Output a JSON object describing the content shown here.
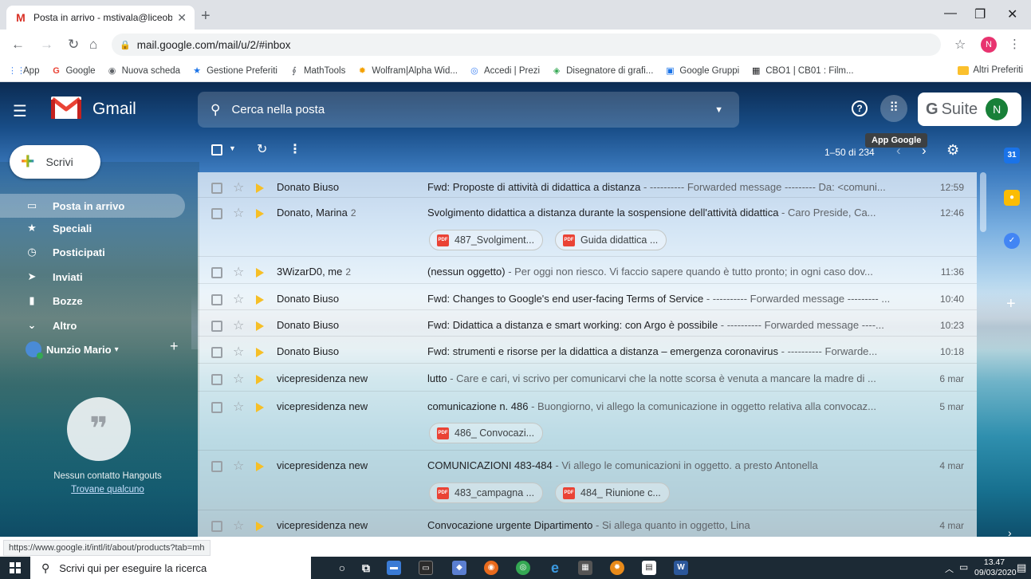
{
  "browser": {
    "tab_title": "Posta in arrivo - mstivala@liceob",
    "new_tab_label": "+",
    "url": "mail.google.com/mail/u/2/#inbox",
    "bookmarks": [
      {
        "icon": "apps-grid-icon",
        "label": "App"
      },
      {
        "icon": "google-icon",
        "label": "Google"
      },
      {
        "icon": "new-tab-icon",
        "label": "Nuova scheda"
      },
      {
        "icon": "star-icon",
        "label": "Gestione Preferiti"
      },
      {
        "icon": "mathtools-icon",
        "label": "MathTools"
      },
      {
        "icon": "wolfram-icon",
        "label": "Wolfram|Alpha Wid..."
      },
      {
        "icon": "prezi-icon",
        "label": "Accedi | Prezi"
      },
      {
        "icon": "geogebra-icon",
        "label": "Disegnatore di grafi..."
      },
      {
        "icon": "google-groups-icon",
        "label": "Google Gruppi"
      },
      {
        "icon": "cbo-icon",
        "label": "CBO1 | CB01 : Film..."
      }
    ],
    "other_bookmarks": "Altri Preferiti",
    "profile_initial": "N"
  },
  "gmail": {
    "brand": "Gmail",
    "search_placeholder": "Cerca nella posta",
    "gsuite_g": "G",
    "gsuite_suite": "Suite",
    "account_initial": "N",
    "apps_tooltip": "App Google",
    "compose_label": "Scrivi",
    "nav": [
      {
        "icon": "inbox-icon",
        "label": "Posta in arrivo",
        "active": true
      },
      {
        "icon": "star-icon",
        "label": "Speciali",
        "active": false
      },
      {
        "icon": "clock-icon",
        "label": "Posticipati",
        "active": false
      },
      {
        "icon": "send-icon",
        "label": "Inviati",
        "active": false
      },
      {
        "icon": "draft-icon",
        "label": "Bozze",
        "active": false
      },
      {
        "icon": "chevron-down-icon",
        "label": "Altro",
        "active": false
      }
    ],
    "account_name": "Nunzio Mario",
    "account_caret": "▾",
    "hangouts_empty": "Nessun contatto Hangouts",
    "hangouts_find": "Trovane qualcuno",
    "pager": "1–50 di 234",
    "emails": [
      {
        "from": "Donato Biuso",
        "count": "",
        "subject": "Fwd: Proposte di attività di didattica a distanza",
        "snippet": " - ---------- Forwarded message --------- Da: <comuni...",
        "time": "12:59",
        "attachments": []
      },
      {
        "from": "Donato, Marina",
        "count": "2",
        "subject": "Svolgimento didattica a distanza durante la sospensione dell'attività didattica",
        "snippet": " - Caro Preside, Ca...",
        "time": "12:46",
        "attachments": [
          "487_Svolgiment...",
          "Guida didattica ..."
        ]
      },
      {
        "from": "3WizarD0, me",
        "count": "2",
        "subject": "(nessun oggetto)",
        "snippet": " - Per oggi non riesco. Vi faccio sapere quando è tutto pronto; in ogni caso dov...",
        "time": "11:36",
        "attachments": []
      },
      {
        "from": "Donato Biuso",
        "count": "",
        "subject": "Fwd: Changes to Google's end user-facing Terms of Service",
        "snippet": " - ---------- Forwarded message --------- ...",
        "time": "10:40",
        "attachments": []
      },
      {
        "from": "Donato Biuso",
        "count": "",
        "subject": "Fwd: Didattica a distanza e smart working: con Argo è possibile",
        "snippet": " - ---------- Forwarded message ----...",
        "time": "10:23",
        "attachments": []
      },
      {
        "from": "Donato Biuso",
        "count": "",
        "subject": "Fwd: strumenti e risorse per la didattica a distanza – emergenza coronavirus",
        "snippet": " - ---------- Forwarde...",
        "time": "10:18",
        "attachments": []
      },
      {
        "from": "vicepresidenza new",
        "count": "",
        "subject": "lutto",
        "snippet": " - Care e cari, vi scrivo per comunicarvi che la notte scorsa è venuta a mancare la madre di ...",
        "time": "6 mar",
        "attachments": []
      },
      {
        "from": "vicepresidenza new",
        "count": "",
        "subject": "comunicazione n. 486",
        "snippet": " - Buongiorno, vi allego la comunicazione in oggetto relativa alla convocaz...",
        "time": "5 mar",
        "attachments": [
          "486_ Convocazi..."
        ]
      },
      {
        "from": "vicepresidenza new",
        "count": "",
        "subject": "COMUNICAZIONI 483-484",
        "snippet": " - Vi allego le comunicazioni in oggetto. a presto Antonella",
        "time": "4 mar",
        "attachments": [
          "483_campagna ...",
          "484_ Riunione c..."
        ]
      },
      {
        "from": "vicepresidenza new",
        "count": "",
        "subject": "Convocazione urgente Dipartimento",
        "snippet": " - Si allega quanto in oggetto, Lina",
        "time": "4 mar",
        "attachments": []
      }
    ],
    "pdf_label": "PDF",
    "status_url": "https://www.google.it/intl/it/about/products?tab=mh"
  },
  "taskbar": {
    "search_placeholder": "Scrivi qui per eseguire la ricerca",
    "time": "13.47",
    "date": "09/03/2020"
  }
}
